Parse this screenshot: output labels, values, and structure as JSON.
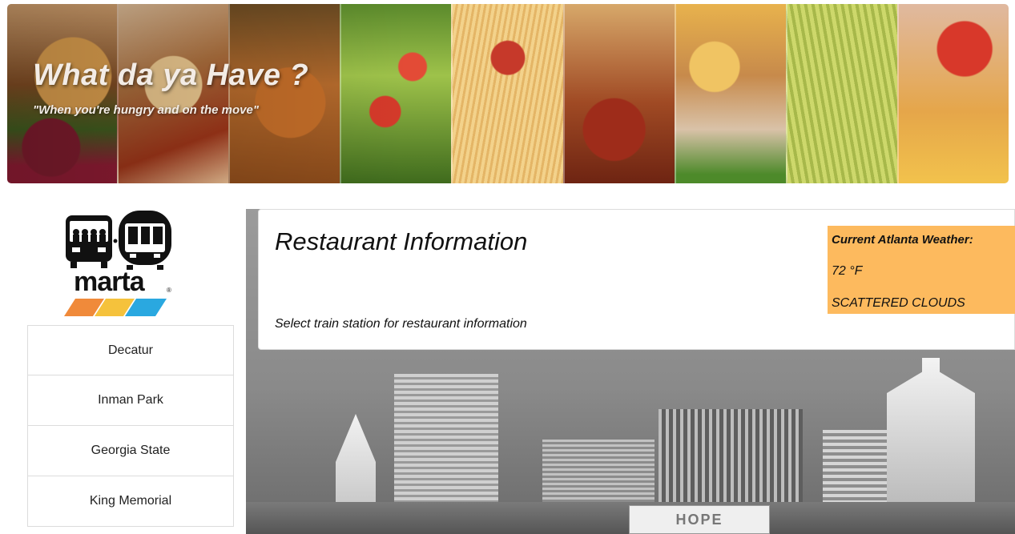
{
  "hero": {
    "title": "What da ya Have ?",
    "tagline": "\"When you're hungry and on the move\""
  },
  "logo": {
    "wordmark": "marta",
    "registered": "®",
    "stripe_colors": [
      "#f08a3a",
      "#f5c23c",
      "#2aa8e0"
    ]
  },
  "stations": [
    {
      "label": "Decatur"
    },
    {
      "label": "Inman Park"
    },
    {
      "label": "Georgia State"
    },
    {
      "label": "King Memorial"
    }
  ],
  "restaurant_info": {
    "heading": "Restaurant Information",
    "instruction": "Select train station for restaurant information"
  },
  "weather": {
    "heading": "Current Atlanta Weather:",
    "temperature": "72 °F",
    "condition": "SCATTERED CLOUDS",
    "panel_color": "#fdba5e"
  },
  "skyline_sign": "HOPE"
}
